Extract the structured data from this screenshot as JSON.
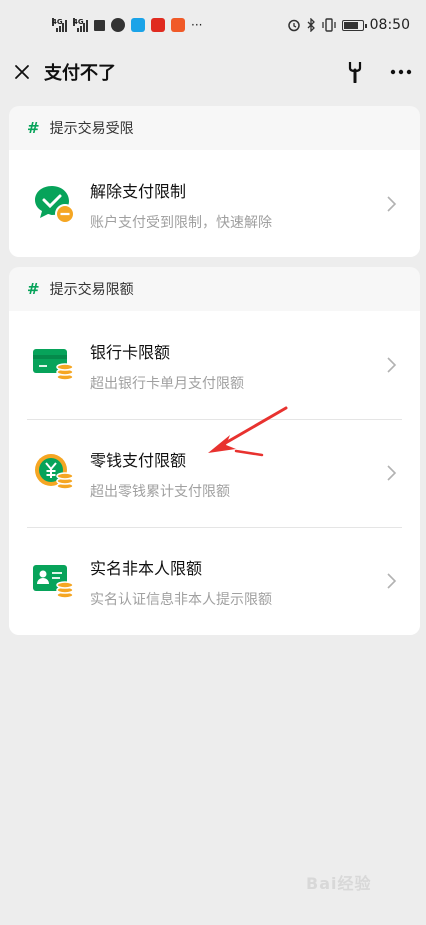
{
  "status_bar": {
    "network1": "4G",
    "network2": "4G",
    "time": "08:50"
  },
  "nav": {
    "title": "支付不了"
  },
  "section1": {
    "header": "提示交易受限",
    "items": [
      {
        "title": "解除支付限制",
        "subtitle": "账户支付受到限制，快速解除"
      }
    ]
  },
  "section2": {
    "header": "提示交易限额",
    "items": [
      {
        "title": "银行卡限额",
        "subtitle": "超出银行卡单月支付限额"
      },
      {
        "title": "零钱支付限额",
        "subtitle": "超出零钱累计支付限额"
      },
      {
        "title": "实名非本人限额",
        "subtitle": "实名认证信息非本人提示限额"
      }
    ]
  },
  "colors": {
    "accent_green": "#07a35a",
    "coin_orange": "#f5a623",
    "arrow_red": "#e8322f"
  },
  "watermark": "Bai经验"
}
